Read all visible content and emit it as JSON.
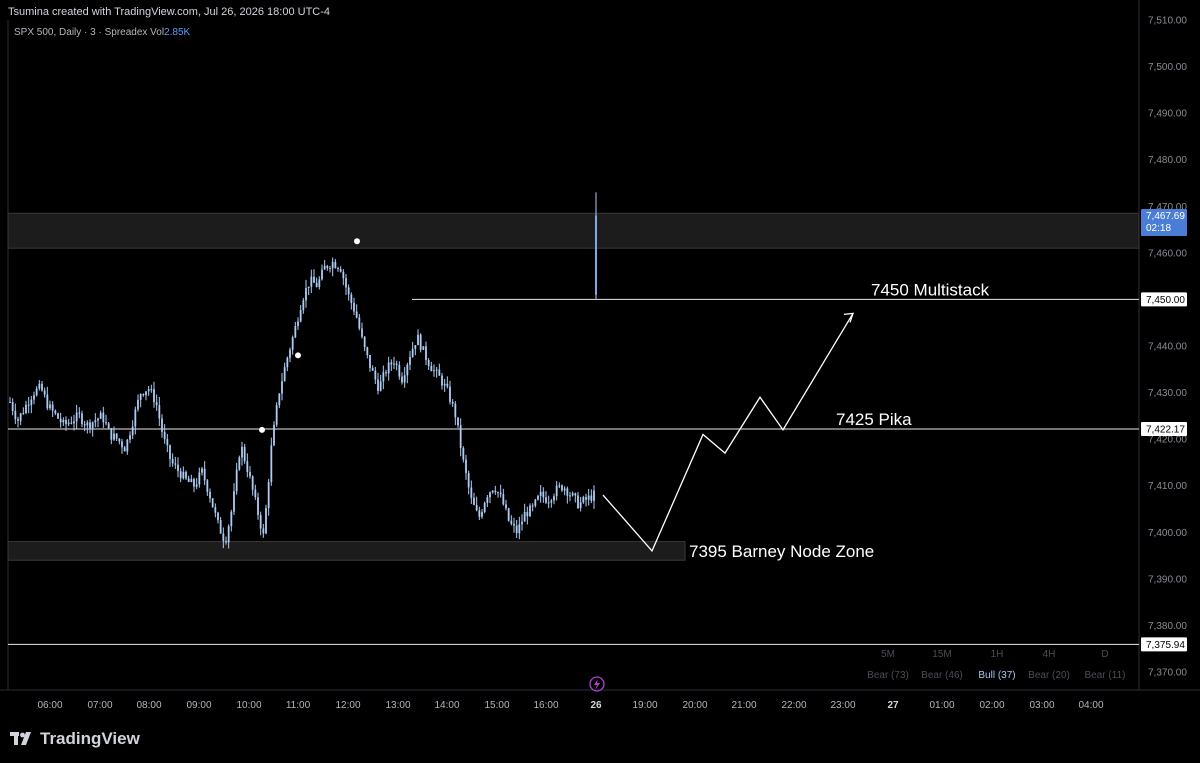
{
  "credit": "Tsumina created with TradingView.com, Jul 26, 2026 18:00 UTC-4",
  "symbol": {
    "text": "SPX 500, Daily · 3 · Spreadex  Vol",
    "volume": "2.85K"
  },
  "brand": "TradingView",
  "colors": {
    "background": "#000000",
    "candle": "#aecdf5",
    "price_label_bg": "#ffffff",
    "current_price_bg": "#4a7ed6",
    "zone_fill": "#1c1c1c",
    "grid_text": "#8a8d96"
  },
  "chart_data": {
    "type": "candlestick",
    "ylim": [
      7366,
      7512
    ],
    "y_ticks": [
      "7,510.00",
      "7,500.00",
      "7,490.00",
      "7,480.00",
      "7,470.00",
      "7,460.00",
      "7,450.00",
      "7,440.00",
      "7,430.00",
      "7,420.00",
      "7,410.00",
      "7,400.00",
      "7,390.00",
      "7,380.00",
      "7,370.00"
    ],
    "x_ticks": [
      "06:00",
      "07:00",
      "08:00",
      "09:00",
      "10:00",
      "11:00",
      "12:00",
      "13:00",
      "14:00",
      "15:00",
      "16:00",
      "26",
      "19:00",
      "20:00",
      "21:00",
      "22:00",
      "23:00",
      "27",
      "01:00",
      "02:00",
      "03:00",
      "04:00"
    ],
    "price_labels": [
      {
        "text": "7,450.00",
        "value": 7450
      },
      {
        "text": "7,422.17",
        "value": 7422.17
      },
      {
        "text": "7,375.94",
        "value": 7375.94
      }
    ],
    "current_price": {
      "text": "7,467.69",
      "countdown": "02:18",
      "value": 7467.69
    },
    "series_close_path": [
      7428,
      7424,
      7427,
      7430,
      7431,
      7427,
      7425,
      7423,
      7424,
      7425,
      7423,
      7424,
      7425,
      7421,
      7420,
      7418,
      7424,
      7430,
      7431,
      7428,
      7420,
      7415,
      7413,
      7411,
      7410,
      7413,
      7408,
      7402,
      7398,
      7406,
      7419,
      7413,
      7406,
      7399,
      7418,
      7430,
      7437,
      7443,
      7450,
      7454,
      7453,
      7457,
      7458,
      7457,
      7451,
      7447,
      7440,
      7435,
      7431,
      7435,
      7437,
      7433,
      7438,
      7442,
      7438,
      7435,
      7433,
      7430,
      7425,
      7415,
      7407,
      7403,
      7408,
      7410,
      7407,
      7402,
      7400,
      7404,
      7405,
      7408,
      7407,
      7409,
      7410,
      7408,
      7406,
      7407,
      7408
    ],
    "post_gap_candle": {
      "open": 7451,
      "high": 7473,
      "low": 7450,
      "close": 7468
    },
    "markers": [
      {
        "label": "high-dot",
        "value": 7462.5
      },
      {
        "label": "mid-dot",
        "value": 7438
      },
      {
        "label": "low-dot",
        "value": 7422
      }
    ],
    "zones": [
      {
        "name": "top-zone",
        "from": 7461,
        "to": 7468.5
      },
      {
        "name": "barney-zone",
        "from": 7394,
        "to": 7398
      }
    ],
    "levels": [
      {
        "name": "multistack",
        "value": 7450
      },
      {
        "name": "pika",
        "value": 7422.17
      },
      {
        "name": "bottom",
        "value": 7375.94
      }
    ],
    "annotations": [
      {
        "text": "7450 Multistack",
        "value": 7450
      },
      {
        "text": "7425 Pika",
        "value": 7422.17
      },
      {
        "text": "7395 Barney Node Zone",
        "value": 7396
      }
    ],
    "projection_path": [
      7408,
      7396,
      7421,
      7417,
      7429,
      7422,
      7447
    ],
    "timeframe_table": {
      "headers": [
        "5M",
        "15M",
        "1H",
        "4H",
        "D"
      ],
      "values": [
        "Bear (73)",
        "Bear (46)",
        "Bull (37)",
        "Bear (20)",
        "Bear (11)"
      ],
      "highlight_index": 2
    }
  }
}
